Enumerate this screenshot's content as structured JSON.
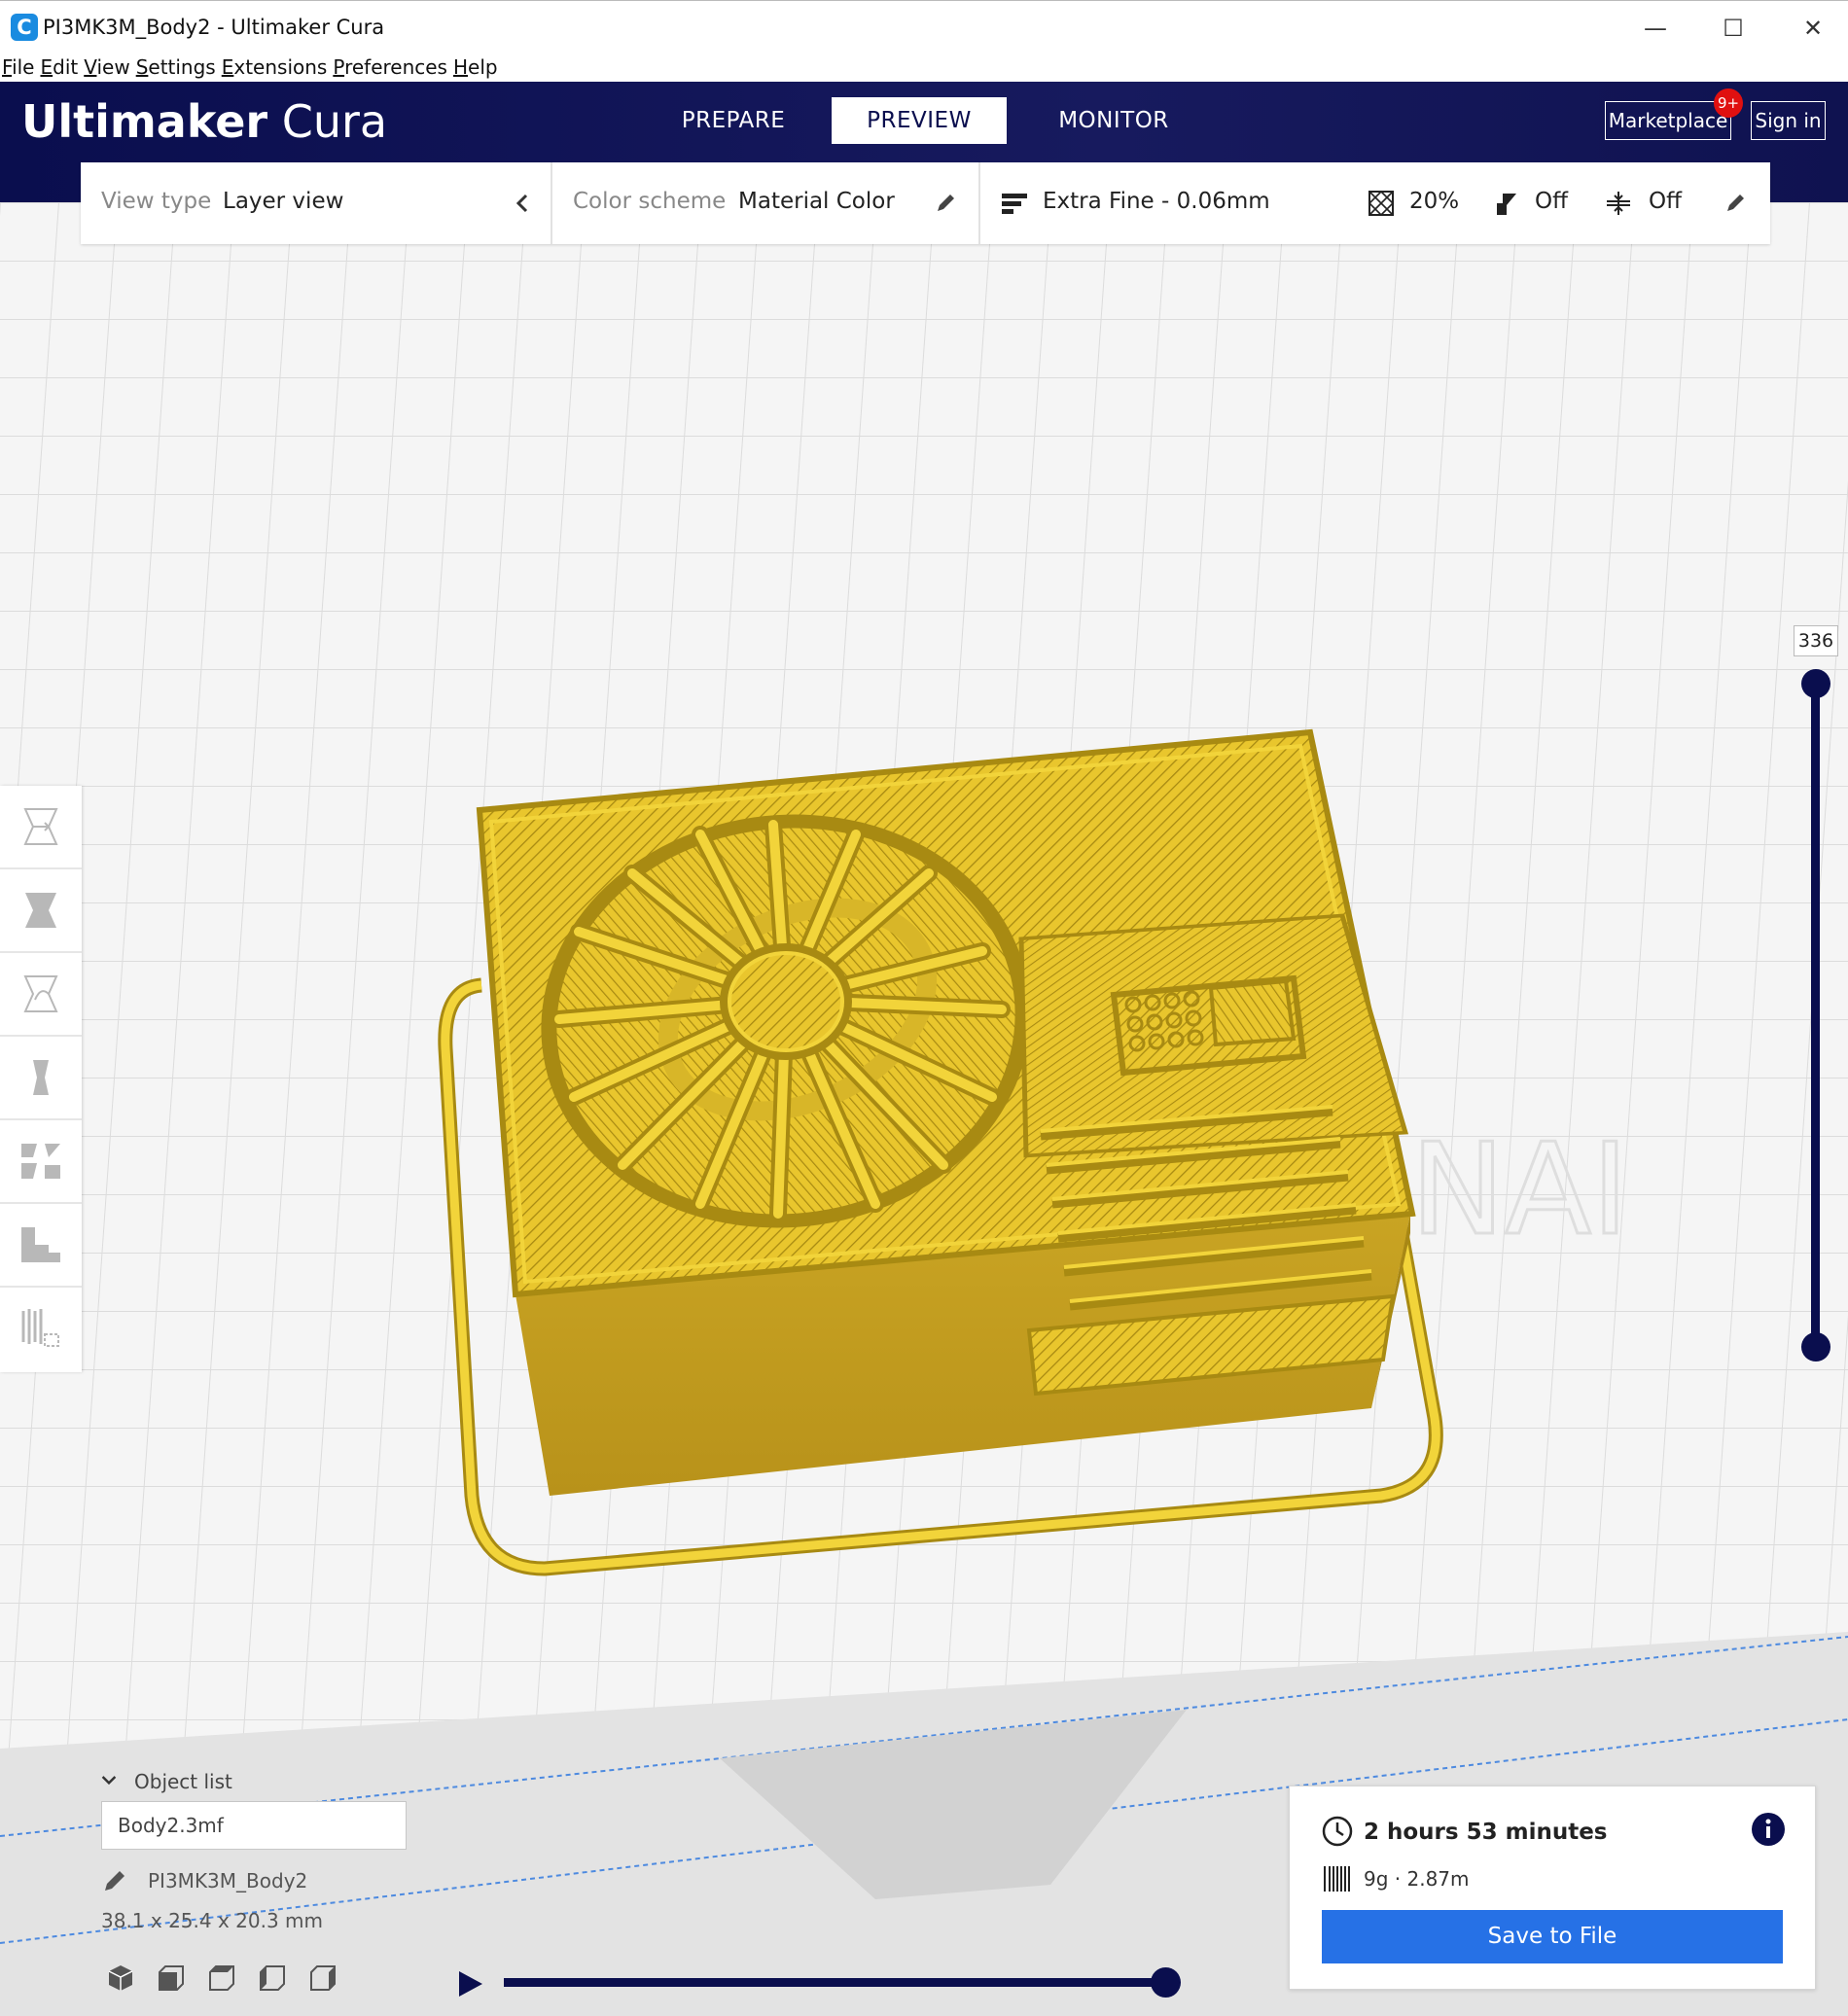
{
  "window": {
    "title": "PI3MK3M_Body2 - Ultimaker Cura",
    "app_icon_glyph": "C",
    "minimize_glyph": "—",
    "maximize_glyph": "☐",
    "close_glyph": "✕"
  },
  "menu": [
    {
      "key": "F",
      "rest": "ile"
    },
    {
      "key": "E",
      "rest": "dit"
    },
    {
      "key": "V",
      "rest": "iew"
    },
    {
      "key": "S",
      "rest": "ettings"
    },
    {
      "key": "E",
      "rest": "xtensions"
    },
    {
      "key": "P",
      "rest": "references"
    },
    {
      "key": "H",
      "rest": "elp"
    }
  ],
  "header": {
    "brand_bold": "Ultimaker",
    "brand_light": "Cura",
    "tabs": {
      "prepare": "PREPARE",
      "preview": "PREVIEW",
      "monitor": "MONITOR"
    },
    "active_tab": "preview",
    "marketplace_label": "Marketplace",
    "marketplace_badge": "9+",
    "signin_label": "Sign in"
  },
  "view_bar": {
    "view_type_label": "View type",
    "view_type_value": "Layer view",
    "color_scheme_label": "Color scheme",
    "color_scheme_value": "Material Color",
    "profile": "Extra Fine - 0.06mm",
    "infill": "20%",
    "support": "Off",
    "adhesion": "Off"
  },
  "layer_slider": {
    "value": "336"
  },
  "object_list": {
    "toggle_label": "Object list",
    "file_name": "Body2.3mf",
    "object_name": "PI3MK3M_Body2",
    "dimensions": "38.1 x 25.4 x 20.3 mm"
  },
  "simulation": {
    "progress": 1.0
  },
  "print_info": {
    "time": "2 hours 53 minutes",
    "usage": "9g · 2.87m",
    "save_label": "Save to File"
  },
  "colors": {
    "header_navy": "#0a0e4e",
    "accent_blue": "#2671e6",
    "material_yellow": "#e8c72c",
    "badge_red": "#e01010"
  },
  "icons": {
    "tools": [
      "move-icon",
      "scale-icon",
      "rotate-icon",
      "mirror-icon",
      "per-model-settings-icon",
      "support-blocker-icon",
      "mesh-tools-icon"
    ],
    "camera": [
      "view-3d-icon",
      "view-front-icon",
      "view-top-icon",
      "view-left-icon",
      "view-right-icon"
    ]
  }
}
